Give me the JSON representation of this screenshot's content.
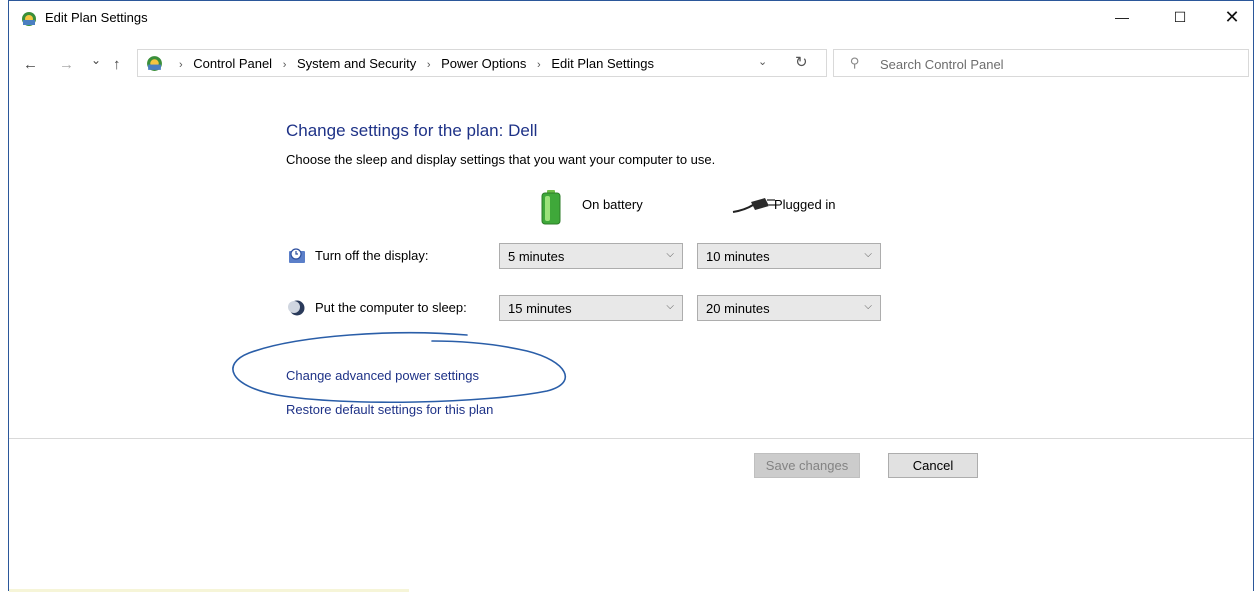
{
  "window": {
    "title": "Edit Plan Settings",
    "minimize_label": "—",
    "maximize_label": "☐",
    "close_label": "✕"
  },
  "nav": {
    "back": "←",
    "forward": "→",
    "recent": "⌄",
    "up": "↑"
  },
  "address": {
    "crumbs": [
      "Control Panel",
      "System and Security",
      "Power Options",
      "Edit Plan Settings"
    ],
    "separator": "›",
    "dropdown": "⌄",
    "refresh": "↻"
  },
  "search": {
    "placeholder": "Search Control Panel"
  },
  "main": {
    "heading": "Change settings for the plan: Dell",
    "subtitle": "Choose the sleep and display settings that you want your computer to use.",
    "col_battery": "On battery",
    "col_plugged": "Plugged in",
    "rows": [
      {
        "label": "Turn off the display:",
        "battery": "5 minutes",
        "plugged": "10 minutes"
      },
      {
        "label": "Put the computer to sleep:",
        "battery": "15 minutes",
        "plugged": "20 minutes"
      }
    ],
    "chevron": "⌵",
    "link_advanced": "Change advanced power settings",
    "link_restore": "Restore default settings for this plan"
  },
  "buttons": {
    "save": "Save changes",
    "cancel": "Cancel"
  },
  "colors": {
    "accent": "#1e3287",
    "annotation_ink": "#2a5ea8"
  }
}
